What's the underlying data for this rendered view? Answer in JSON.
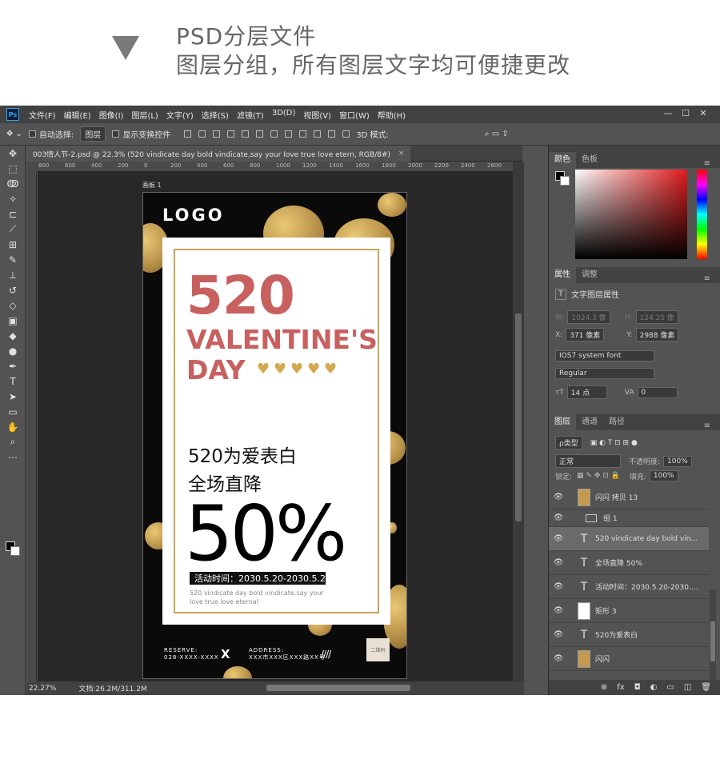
{
  "header": {
    "line1": "PSD分层文件",
    "line2": "图层分组，所有图层文字均可便捷更改"
  },
  "app": {
    "logo": "Ps",
    "menu": [
      "文件(F)",
      "编辑(E)",
      "图像(I)",
      "图层(L)",
      "文字(Y)",
      "选择(S)",
      "滤镜(T)",
      "3D(D)",
      "视图(V)",
      "窗口(W)",
      "帮助(H)"
    ],
    "win": [
      "—",
      "☐",
      "✕"
    ]
  },
  "options": {
    "auto_select": "自动选择:",
    "layer_dd": "图层",
    "transform": "显示变换控件",
    "mode3d": "3D 模式:"
  },
  "document": {
    "tab": "003情人节-2.psd @ 22.3% (520 vindicate day bold vindicate,say your  love true love etern, RGB/8#)",
    "close": "×",
    "artboard_label": "画板 1",
    "zoom": "22.27%",
    "doc_size": "文档:26.2M/311.2M"
  },
  "ruler": [
    "800",
    "600",
    "400",
    "200",
    "0",
    "200",
    "400",
    "600",
    "800",
    "1000",
    "1200",
    "1400",
    "1600",
    "1800",
    "2000",
    "2200",
    "2400",
    "2600"
  ],
  "poster": {
    "logo": "LOGO",
    "big520": "520",
    "valentines": "VALENTINE'S",
    "day": "DAY",
    "line1": "520为爱表白",
    "line2": "全场直降",
    "discount": "50%",
    "activity": "活动时间：2030.5.20-2030.5.22",
    "eng1": "520 vindicate day bold vindicate,say your",
    "eng2": "love true love eternal",
    "reserve_label": "RESERVE:",
    "reserve_value": "028-XXXX-XXXX",
    "x": "X",
    "address_label": "ADDRESS:",
    "address_value": "XXX市XXX区XXX路XX号",
    "slashes": "////",
    "qr": "二维码"
  },
  "panels": {
    "color_tabs": [
      "颜色",
      "色板"
    ],
    "prop_tabs": [
      "属性",
      "调整"
    ],
    "prop_title": "文字图层属性",
    "w_label": "W:",
    "w_val": "1024.3 像",
    "h_label": "H:",
    "h_val": "124.25 像",
    "x_label": "X:",
    "x_val": "371 像素",
    "y_label": "Y:",
    "y_val": "2988 像素",
    "font": "IOS7 system font",
    "style": "Regular",
    "size": "14 点",
    "tracking": "0",
    "layer_tabs": [
      "图层",
      "通道",
      "路径"
    ],
    "kind": "ρ类型",
    "blend": "正常",
    "opacity_label": "不透明度:",
    "opacity": "100%",
    "lock_label": "锁定:",
    "fill_label": "填充:",
    "fill": "100%"
  },
  "layers": [
    {
      "name": "闪闪 拷贝 13",
      "kind": "gold"
    },
    {
      "name": "组 1",
      "kind": "folder"
    },
    {
      "name": "520 vindicate day bold vindica...",
      "kind": "text",
      "selected": true
    },
    {
      "name": "全场直降 50%",
      "kind": "text"
    },
    {
      "name": "活动时间：2030.5.20-2030.5...",
      "kind": "text"
    },
    {
      "name": "矩形 3",
      "kind": "rect"
    },
    {
      "name": "520为爱表白",
      "kind": "text"
    },
    {
      "name": "闪闪",
      "kind": "gold"
    }
  ],
  "layer_footer": [
    "⊕",
    "fx",
    "◘",
    "◐",
    "▭",
    "◫",
    "🗑"
  ]
}
